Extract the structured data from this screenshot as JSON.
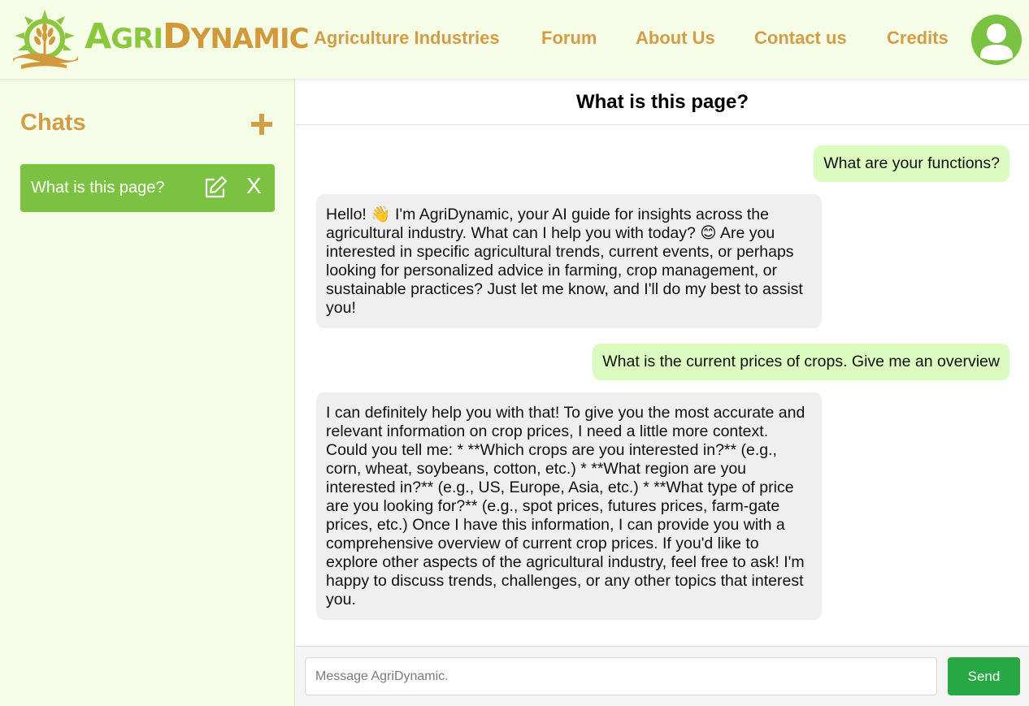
{
  "header": {
    "brand_part1_big": "A",
    "brand_part1_rest": "GRI",
    "brand_part2_big": "D",
    "brand_part2_rest": "YNAMIC",
    "nav": [
      {
        "label": "Agriculture Industries"
      },
      {
        "label": "Forum"
      },
      {
        "label": "About Us"
      },
      {
        "label": "Contact us"
      },
      {
        "label": "Credits"
      }
    ]
  },
  "sidebar": {
    "title": "Chats",
    "chats": [
      {
        "label": "What is this page?"
      }
    ],
    "close_label": "X"
  },
  "main": {
    "title": "What is this page?",
    "messages": [
      {
        "role": "user",
        "text": "What are your functions?"
      },
      {
        "role": "bot",
        "text": "Hello! 👋 I'm AgriDynamic, your AI guide for insights across the agricultural industry. What can I help you with today? 😊 Are you interested in specific agricultural trends, current events, or perhaps looking for personalized advice in farming, crop management, or sustainable practices? Just let me know, and I'll do my best to assist you!"
      },
      {
        "role": "user",
        "text": "What is the current prices of crops. Give me an overview"
      },
      {
        "role": "bot",
        "text": "I can definitely help you with that! To give you the most accurate and relevant information on crop prices, I need a little more context. Could you tell me: * **Which crops are you interested in?** (e.g., corn, wheat, soybeans, cotton, etc.) * **What region are you interested in?** (e.g., US, Europe, Asia, etc.) * **What type of price are you looking for?** (e.g., spot prices, futures prices, farm-gate prices, etc.) Once I have this information, I can provide you with a comprehensive overview of current crop prices. If you'd like to explore other aspects of the agricultural industry, feel free to ask! I'm happy to discuss trends, challenges, or any other topics that interest you."
      }
    ],
    "input": {
      "placeholder": "Message AgriDynamic.",
      "value": ""
    },
    "send_label": "Send"
  },
  "colors": {
    "green": "#7cc242",
    "gold": "#d19d47",
    "header_bg": "#f5fde6",
    "user_bubble": "#dcfbc0",
    "bot_bubble": "#efefef",
    "send": "#28a745"
  },
  "icons": {
    "logo": "wheat-sun-logo-icon",
    "avatar": "user-avatar-icon",
    "add": "plus-icon",
    "edit": "edit-pencil-icon"
  }
}
